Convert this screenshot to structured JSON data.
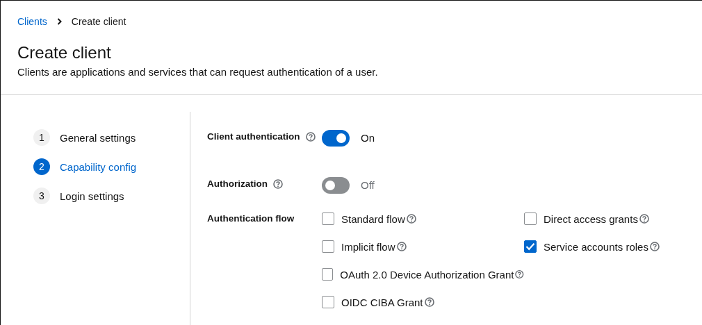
{
  "breadcrumb": [
    {
      "label": "Clients"
    },
    {
      "label": "Create client"
    }
  ],
  "title": "Create client",
  "description": "Clients are applications and services that can request authentication of a user.",
  "steps": [
    {
      "number": "1",
      "label": "General settings",
      "selected": false
    },
    {
      "number": "2",
      "label": "Capability config",
      "selected": true
    },
    {
      "number": "3",
      "label": "Login settings",
      "selected": false
    }
  ],
  "fields": [
    {
      "kind": "switch",
      "label": "Client authentication",
      "on": true,
      "state_label": "On"
    },
    {
      "kind": "switch",
      "label": "Authorization",
      "on": false,
      "state_label": "Off"
    },
    {
      "kind": "checkboxes",
      "label": "Authentication flow",
      "options": [
        {
          "label": "Standard flow",
          "checked": false
        },
        {
          "label": "Direct access grants",
          "checked": false
        },
        {
          "label": "Implicit flow",
          "checked": false
        },
        {
          "label": "Service accounts roles",
          "checked": true
        },
        {
          "label": "OAuth 2.0 Device Authorization Grant",
          "checked": false
        },
        {
          "label": "OIDC CIBA Grant",
          "checked": false
        }
      ]
    }
  ]
}
